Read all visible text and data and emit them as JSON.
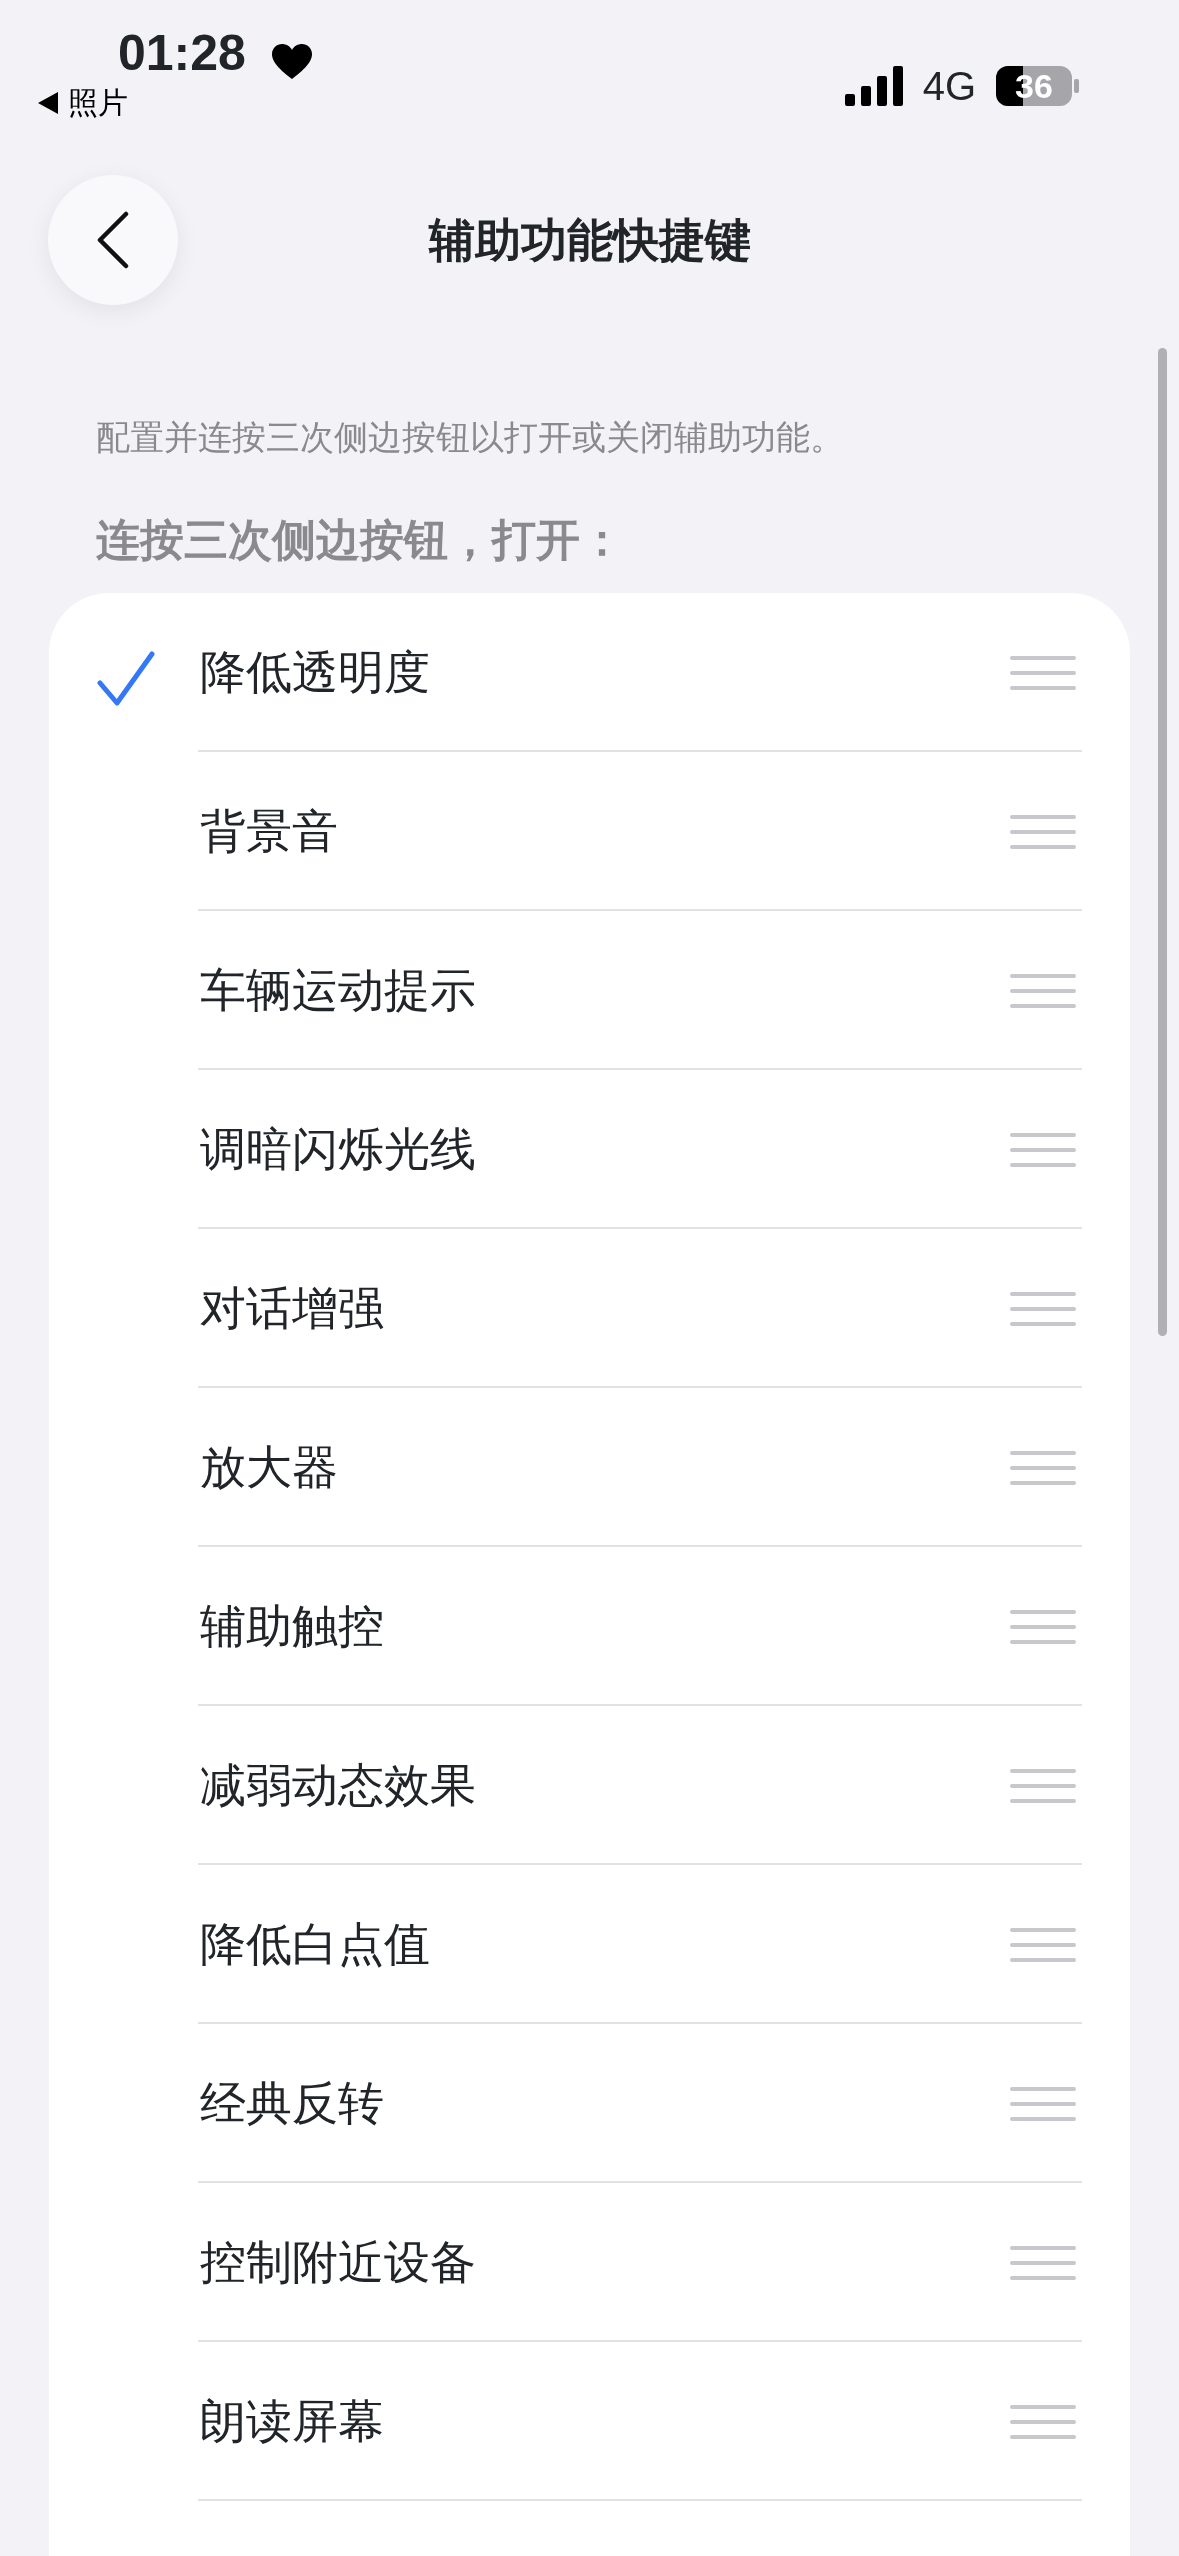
{
  "status_bar": {
    "time": "01:28",
    "back_app": "照片",
    "network": "4G",
    "battery": "36"
  },
  "nav": {
    "title": "辅助功能快捷键"
  },
  "description": "配置并连按三次侧边按钮以打开或关闭辅助功能。",
  "section_header": "连按三次侧边按钮，打开：",
  "items": [
    {
      "label": "降低透明度",
      "checked": true
    },
    {
      "label": "背景音",
      "checked": false
    },
    {
      "label": "车辆运动提示",
      "checked": false
    },
    {
      "label": "调暗闪烁光线",
      "checked": false
    },
    {
      "label": "对话增强",
      "checked": false
    },
    {
      "label": "放大器",
      "checked": false
    },
    {
      "label": "辅助触控",
      "checked": false
    },
    {
      "label": "减弱动态效果",
      "checked": false
    },
    {
      "label": "降低白点值",
      "checked": false
    },
    {
      "label": "经典反转",
      "checked": false
    },
    {
      "label": "控制附近设备",
      "checked": false
    },
    {
      "label": "朗读屏幕",
      "checked": false
    }
  ]
}
